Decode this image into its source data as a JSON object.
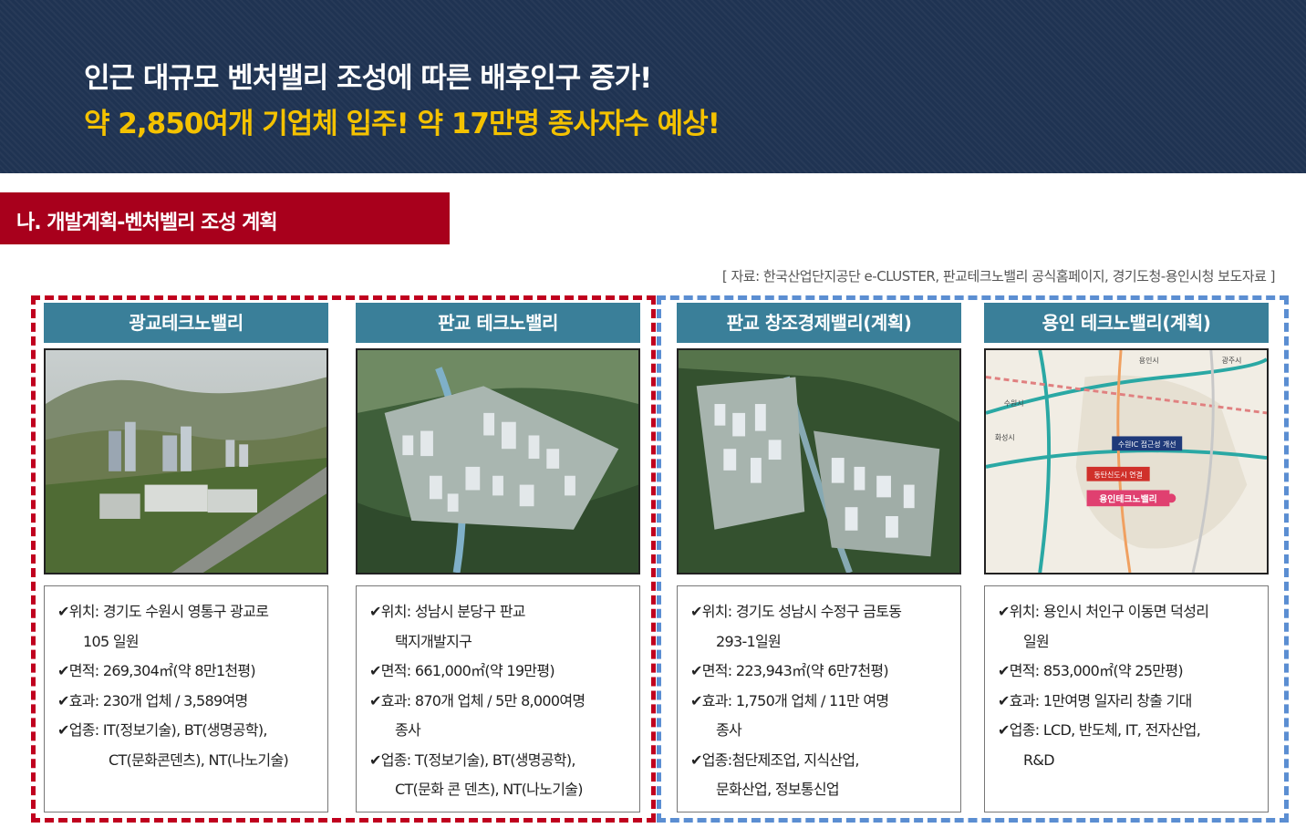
{
  "banner": {
    "line1": "인근 대규모 벤처밸리 조성에 따른 배후인구 증가!",
    "line2": "약 2,850여개 기업체 입주! 약 17만명 종사자수 예상!"
  },
  "section": {
    "title": "나. 개발계획-벤처벨리 조성 계획"
  },
  "source": "[ 자료: 한국산업단지공단 e-CLUSTER, 판교테크노밸리 공식홈페이지, 경기도청-용인시청 보도자료 ]",
  "check_mark": "✔",
  "columns": [
    {
      "title": "광교테크노밸리",
      "lines": [
        "위치: 경기도 수원시 영통구 광교로",
        "105 일원",
        "면적: 269,304㎡(약 8만1천평)",
        "효과: 230개 업체 / 3,589여명",
        "업종: IT(정보기술), BT(생명공학),",
        "CT(문화콘덴츠), NT(나노기술)"
      ]
    },
    {
      "title": "판교 테크노밸리",
      "lines": [
        "위치: 성남시 분당구 판교",
        "택지개발지구",
        "면적: 661,000㎡(약 19만평)",
        "효과: 870개 업체 / 5만 8,000여명",
        "종사",
        "업종: T(정보기술), BT(생명공학),",
        "CT(문화 콘 덴츠), NT(나노기술)"
      ]
    },
    {
      "title": "판교 창조경제밸리(계획)",
      "lines": [
        "위치: 경기도 성남시 수정구 금토동",
        "293-1일원",
        "면적: 223,943㎡(약 6만7천평)",
        "효과: 1,750개 업체 / 11만 여명",
        "종사",
        "업종:첨단제조업, 지식산업,",
        "문화산업, 정보통신업"
      ]
    },
    {
      "title": "용인 테크노밸리(계획)",
      "lines": [
        "위치: 용인시 처인구 이동면 덕성리",
        "일원",
        "면적: 853,000㎡(약 25만평)",
        "효과: 1만여명 일자리 창출 기대",
        "업종: LCD, 반도체, IT, 전자산업,",
        "R&D"
      ]
    }
  ],
  "map": {
    "labels": [
      "용인시",
      "수원시",
      "수원IC 접근성 개선",
      "동탄신도시 연결",
      "용인테크노밸리",
      "광주시",
      "화성시"
    ]
  },
  "colors": {
    "banner": "#1f3352",
    "accent_yellow": "#f4c200",
    "section_red": "#a8001c",
    "header_teal": "#3a7f99",
    "dash_red": "#c0001e",
    "dash_blue": "#5b8ed2"
  }
}
